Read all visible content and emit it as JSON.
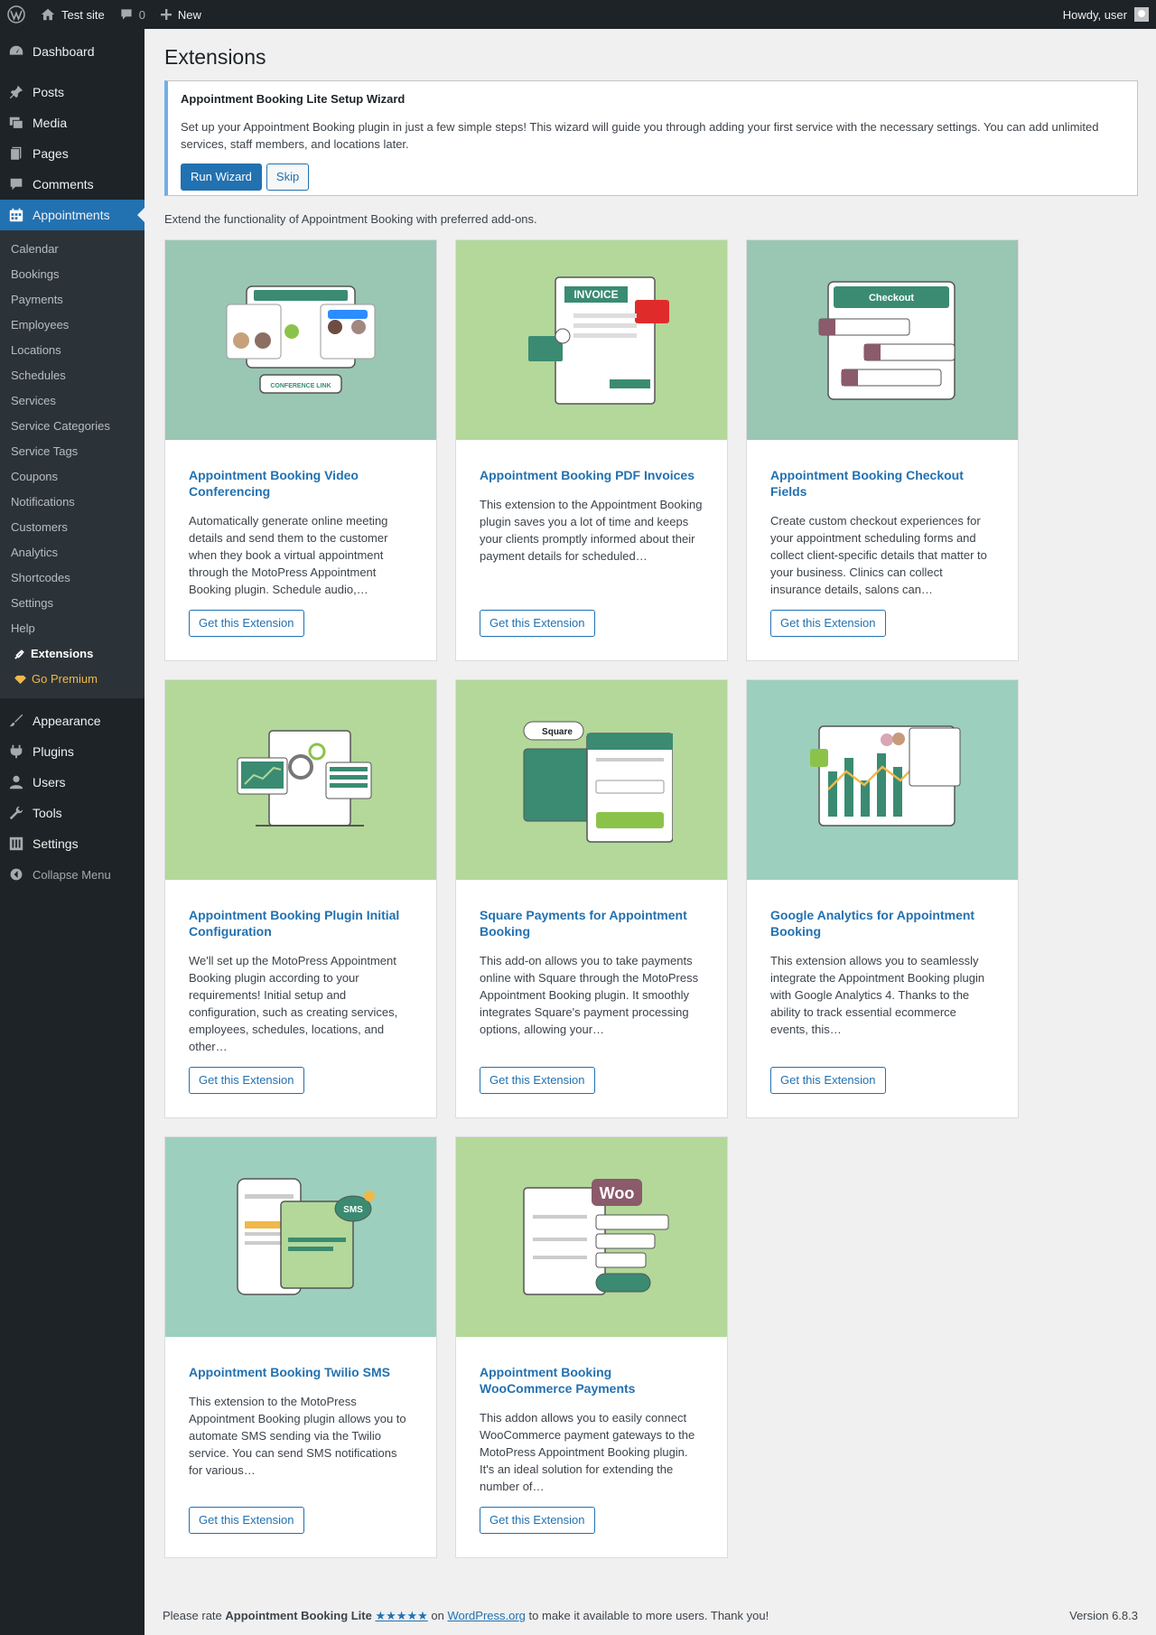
{
  "adminbar": {
    "site_name": "Test site",
    "comments_count": "0",
    "new_label": "New",
    "howdy": "Howdy, user"
  },
  "sidebar": {
    "top_items": [
      {
        "label": "Dashboard",
        "icon": "dashboard-icon"
      },
      {
        "label": "Posts",
        "icon": "pin-icon"
      },
      {
        "label": "Media",
        "icon": "media-icon"
      },
      {
        "label": "Pages",
        "icon": "pages-icon"
      },
      {
        "label": "Comments",
        "icon": "comment-icon"
      },
      {
        "label": "Appointments",
        "icon": "calendar-icon"
      }
    ],
    "sub_items": [
      "Calendar",
      "Bookings",
      "Payments",
      "Employees",
      "Locations",
      "Schedules",
      "Services",
      "Service Categories",
      "Service Tags",
      "Coupons",
      "Notifications",
      "Customers",
      "Analytics",
      "Shortcodes",
      "Settings",
      "Help"
    ],
    "extensions_label": "Extensions",
    "premium_label": "Go Premium",
    "bottom_items": [
      {
        "label": "Appearance",
        "icon": "brush-icon"
      },
      {
        "label": "Plugins",
        "icon": "plugin-icon"
      },
      {
        "label": "Users",
        "icon": "user-icon"
      },
      {
        "label": "Tools",
        "icon": "wrench-icon"
      },
      {
        "label": "Settings",
        "icon": "settings-icon"
      }
    ],
    "collapse_label": "Collapse Menu"
  },
  "page": {
    "title": "Extensions",
    "notice_title": "Appointment Booking Lite Setup Wizard",
    "notice_text": "Set up your Appointment Booking plugin in just a few simple steps! This wizard will guide you through adding your first service with the necessary settings. You can add unlimited services, staff members, and locations later.",
    "run_wizard": "Run Wizard",
    "skip": "Skip",
    "intro": "Extend the functionality of Appointment Booking with preferred add-ons."
  },
  "cards": [
    {
      "title": "Appointment Booking Video Conferencing",
      "desc": "Automatically generate online meeting details and send them to the customer when they book a virtual appointment through the MotoPress Appointment Booking plugin. Schedule audio,…",
      "button": "Get this Extension",
      "bg": "#9ac6b4",
      "img_label": "CONFERENCE LINK"
    },
    {
      "title": "Appointment Booking PDF Invoices",
      "desc": "This extension to the Appointment Booking plugin saves you a lot of time and keeps your clients promptly informed about their payment details for scheduled…",
      "button": "Get this Extension",
      "bg": "#b3d89a",
      "img_label": "INVOICE"
    },
    {
      "title": "Appointment Booking Checkout Fields",
      "desc": "Create custom checkout experiences for your appointment scheduling forms and collect client-specific details that matter to your business. Clinics can collect insurance details, salons can…",
      "button": "Get this Extension",
      "bg": "#9ac6b4",
      "img_label": "Checkout"
    },
    {
      "title": "Appointment Booking Plugin Initial Configuration",
      "desc": "We'll set up the MotoPress Appointment Booking plugin according to your requirements! Initial setup and configuration, such as creating services, employees, schedules, locations, and other…",
      "button": "Get this Extension",
      "bg": "#b3d89a",
      "img_label": ""
    },
    {
      "title": "Square Payments for Appointment Booking",
      "desc": "This add-on allows you to take payments online with Square through the MotoPress Appointment Booking plugin. It smoothly integrates Square's payment processing options, allowing your…",
      "button": "Get this Extension",
      "bg": "#b3d89a",
      "img_label": "Square"
    },
    {
      "title": "Google Analytics for Appointment Booking",
      "desc": "This extension allows you to seamlessly integrate the Appointment Booking plugin with Google Analytics 4. Thanks to the ability to track essential ecommerce events, this…",
      "button": "Get this Extension",
      "bg": "#9ccfbe",
      "img_label": ""
    },
    {
      "title": "Appointment Booking Twilio SMS",
      "desc": "This extension to the MotoPress Appointment Booking plugin allows you to automate SMS sending via the Twilio service. You can send SMS notifications for various…",
      "button": "Get this Extension",
      "bg": "#9ccfbe",
      "img_label": "SMS"
    },
    {
      "title": "Appointment Booking WooCommerce Payments",
      "desc": "This addon allows you to easily connect WooCommerce payment gateways to the MotoPress Appointment Booking plugin. It's an ideal solution for extending the number of…",
      "button": "Get this Extension",
      "bg": "#b3d89a",
      "img_label": "Woo"
    }
  ],
  "footer": {
    "text_before": "Please rate ",
    "plugin_name": "Appointment Booking Lite",
    "stars": "★★★★★",
    "on": " on ",
    "wp_link": "WordPress.org",
    "text_after": " to make it available to more users. Thank you!",
    "version": "Version 6.8.3"
  }
}
